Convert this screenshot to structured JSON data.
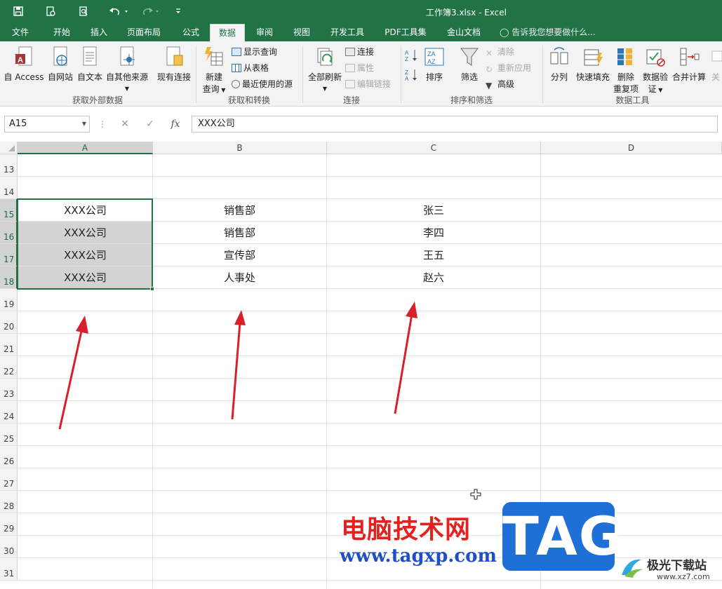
{
  "window": {
    "title": "工作簿3.xlsx - Excel"
  },
  "tabs": [
    "文件",
    "开始",
    "插入",
    "页面布局",
    "公式",
    "数据",
    "审阅",
    "视图",
    "开发工具",
    "PDF工具集",
    "金山文档"
  ],
  "active_tab": "数据",
  "tell_me": "告诉我您想要做什么...",
  "ribbon": {
    "groups": [
      "获取外部数据",
      "获取和转换",
      "连接",
      "排序和筛选",
      "数据工具"
    ],
    "get_external": [
      "自 Access",
      "自网站",
      "自文本",
      "自其他来源",
      "现有连接"
    ],
    "new_query": [
      "新建",
      "查询"
    ],
    "transform_small": [
      "显示查询",
      "从表格",
      "最近使用的源"
    ],
    "refresh_all": "全部刷新",
    "connections_small": [
      "连接",
      "属性",
      "编辑链接"
    ],
    "sort": "排序",
    "filter": "筛选",
    "filter_small": [
      "清除",
      "重新应用",
      "高级"
    ],
    "tools": [
      "分列",
      "快速填充",
      "删除",
      "重复项",
      "数据验",
      "证",
      "合并计算",
      "关"
    ]
  },
  "formula_bar": {
    "name_box": "A15",
    "formula": "XXX公司",
    "fx": "fx"
  },
  "columns": [
    "A",
    "B",
    "C",
    "D"
  ],
  "selected_column": "A",
  "rows": [
    "13",
    "14",
    "15",
    "16",
    "17",
    "18",
    "19",
    "20",
    "21",
    "22",
    "23",
    "24",
    "25",
    "26",
    "27",
    "28",
    "29",
    "30",
    "31"
  ],
  "selected_rows": [
    "15",
    "16",
    "17",
    "18"
  ],
  "cells": [
    [
      "XXX公司",
      "销售部",
      "张三"
    ],
    [
      "XXX公司",
      "销售部",
      "李四"
    ],
    [
      "XXX公司",
      "宣传部",
      "王五"
    ],
    [
      "XXX公司",
      "人事处",
      "赵六"
    ]
  ],
  "watermark": {
    "text": "电脑技术网",
    "url": "www.tagxp.com",
    "tag": "TAG",
    "site_name": "极光下载站",
    "site_url": "www.xz7.com"
  },
  "colors": {
    "excel_green": "#217346",
    "arrow_red": "#d9202a",
    "watermark_blue": "#1e6fd6"
  }
}
